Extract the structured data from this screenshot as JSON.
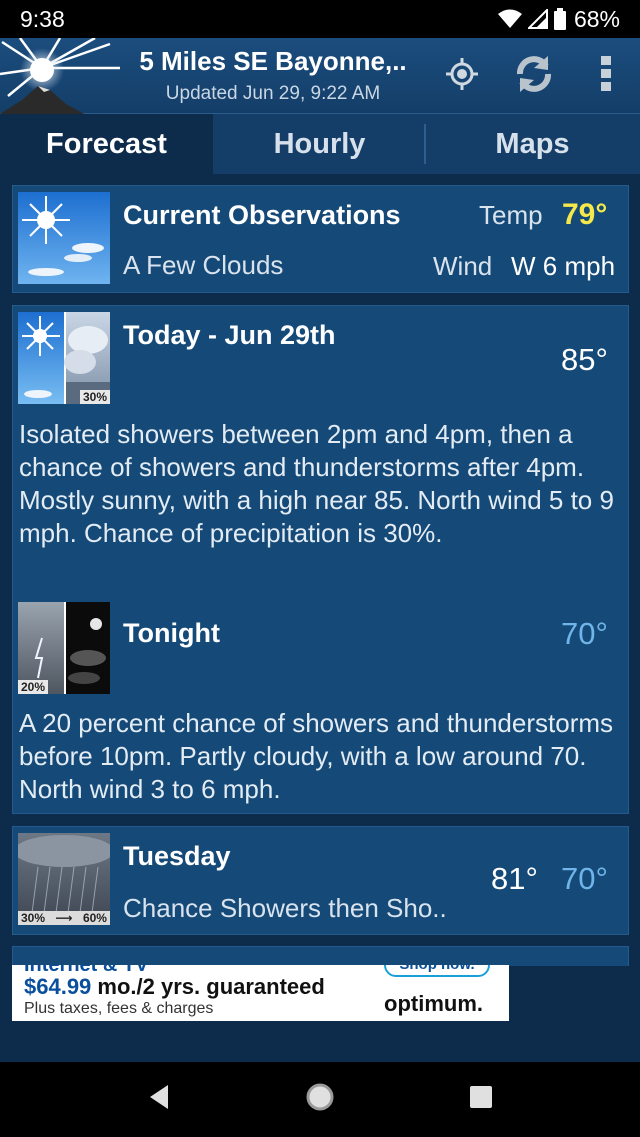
{
  "status": {
    "time": "9:38",
    "battery": "68%",
    "icons": [
      "wifi-icon",
      "signal-icon",
      "battery-icon"
    ]
  },
  "header": {
    "title": "5 Miles SE Bayonne,..",
    "updated": "Updated Jun 29, 9:22 AM",
    "actions": [
      "location-icon",
      "refresh-icon",
      "more-vert-icon"
    ]
  },
  "tabs": [
    {
      "label": "Forecast",
      "active": true
    },
    {
      "label": "Hourly",
      "active": false
    },
    {
      "label": "Maps",
      "active": false
    }
  ],
  "current": {
    "title": "Current Observations",
    "condition": "A Few Clouds",
    "temp_label": "Temp",
    "temp_value": "79°",
    "wind_label": "Wind",
    "wind_value": "W 6 mph"
  },
  "periods": [
    {
      "name": "Today - Jun 29th",
      "high": "85°",
      "pop": "30%",
      "description": "Isolated showers between 2pm and 4pm, then a chance of showers and thunderstorms after 4pm.  Mostly sunny, with a high near 85. North wind 5 to 9 mph.  Chance of precipitation is 30%."
    },
    {
      "name": "Tonight",
      "low": "70°",
      "pop": "20%",
      "description": "A 20 percent chance of showers and thunderstorms before 10pm.  Partly cloudy, with a low around 70. North wind 3 to 6 mph."
    },
    {
      "name": "Tuesday",
      "high": "81°",
      "low": "70°",
      "pop": "30%",
      "pop2": "60%",
      "summary": "Chance Showers then Sho.."
    }
  ],
  "ad": {
    "headline": "Internet & TV",
    "price": "$64.99",
    "offer": "mo./2 yrs. guaranteed",
    "fineprint": "Plus taxes, fees & charges",
    "cta": "Shop now.",
    "brand": "optimum."
  },
  "colors": {
    "background": "#0d2c4b",
    "card": "#154a78",
    "current_temp": "#f5e84a",
    "low_temp": "#6fb5ea",
    "ad_accent": "#0a4f9c"
  }
}
